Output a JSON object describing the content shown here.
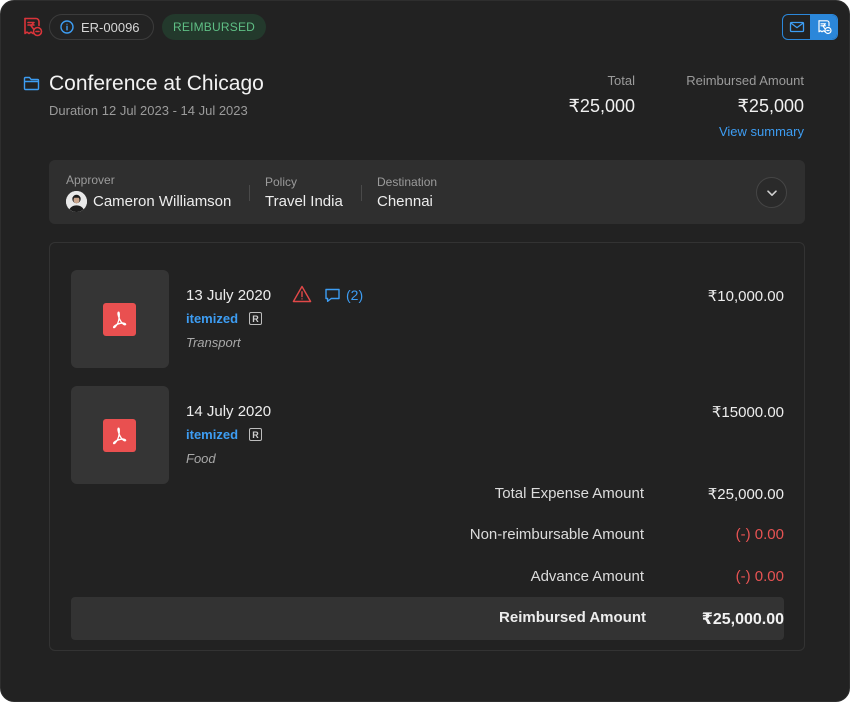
{
  "topbar": {
    "report_id": "ER-00096",
    "status": "REIMBURSED",
    "colors": {
      "status_bg": "#23392c",
      "status_text": "#5fbf85",
      "accent": "#2b87da",
      "logo": "#d9343a"
    },
    "icons": {
      "logo": "rupee-receipt-icon",
      "info": "info-icon",
      "mail": "mail-icon",
      "receipt": "rupee-receipt-icon"
    }
  },
  "header": {
    "title": "Conference at Chicago",
    "duration": "Duration 12 Jul 2023 - 14 Jul 2023",
    "total_label": "Total",
    "total_value": "₹25,000",
    "reimbursed_label": "Reimbursed Amount",
    "reimbursed_value": "₹25,000",
    "view_summary": "View summary"
  },
  "details": {
    "approver_label": "Approver",
    "approver_name": "Cameron Williamson",
    "policy_label": "Policy",
    "policy_value": "Travel India",
    "destination_label": "Destination",
    "destination_value": "Chennai"
  },
  "expenses": [
    {
      "date": "13 July 2020",
      "type": "itemized",
      "badge": "R",
      "category": "Transport",
      "amount": "₹10,000.00",
      "comments": "(2)"
    },
    {
      "date": "14 July 2020",
      "type": "itemized",
      "badge": "R",
      "category": "Food",
      "amount": "₹15000.00"
    }
  ],
  "summary": {
    "total_expense_label": "Total Expense Amount",
    "total_expense_value": "₹25,000.00",
    "non_reimbursable_label": "Non-reimbursable Amount",
    "non_reimbursable_value": "(-) 0.00",
    "advance_label": "Advance Amount",
    "advance_value": "(-) 0.00",
    "reimbursed_label": "Reimbursed Amount",
    "reimbursed_value": "₹25,000.00"
  }
}
